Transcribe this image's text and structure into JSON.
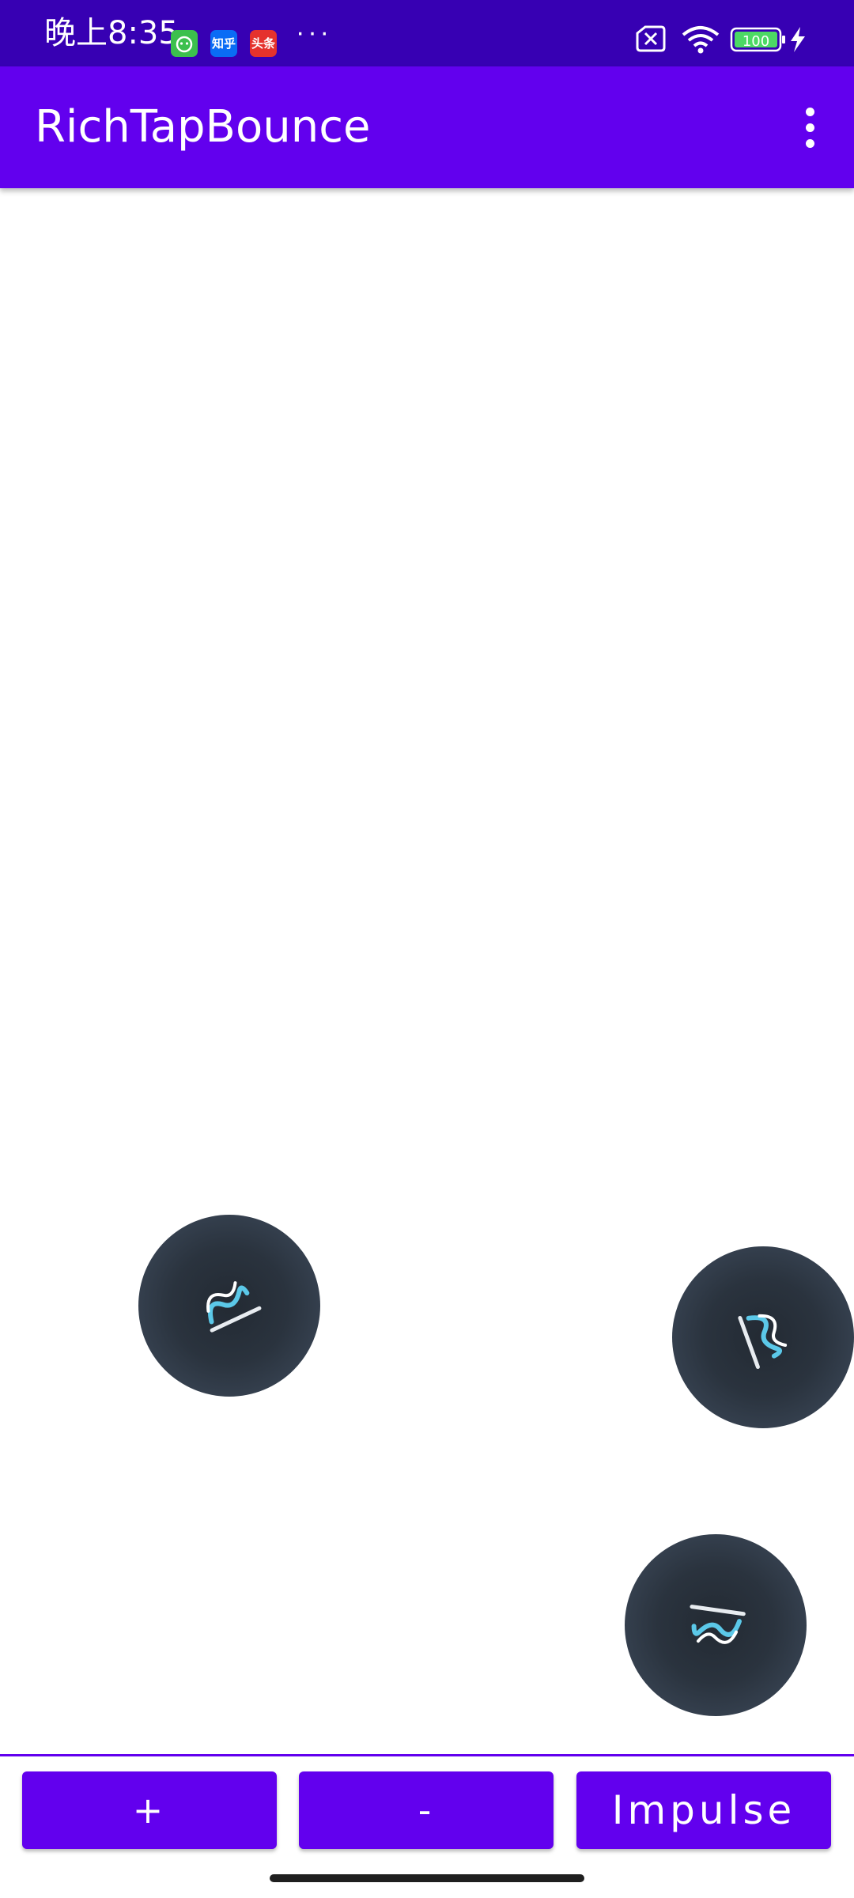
{
  "status_bar": {
    "time": "晚上8:35",
    "notifications": [
      {
        "icon": "wechat-icon",
        "label": "",
        "color": "#3cc04d"
      },
      {
        "icon": "zhihu-icon",
        "label": "知乎",
        "color": "#0a6cf5"
      },
      {
        "icon": "toutiao-icon",
        "label": "头条",
        "color": "#e5322d"
      }
    ],
    "more": "···",
    "battery": "100"
  },
  "app_bar": {
    "title": "RichTapBounce",
    "menu_icon": "more-vert-icon"
  },
  "balls": [
    {
      "name": "ball-1",
      "icon": "richtap-logo-icon"
    },
    {
      "name": "ball-2",
      "icon": "richtap-logo-icon"
    },
    {
      "name": "ball-3",
      "icon": "richtap-logo-icon"
    }
  ],
  "controls": {
    "plus_label": "+",
    "minus_label": "-",
    "impulse_label": "Impulse"
  },
  "colors": {
    "primary": "#6200ee",
    "primary_dark": "#3700b3",
    "ball": "#2a333e",
    "logo_cyan": "#5bc8e8"
  }
}
